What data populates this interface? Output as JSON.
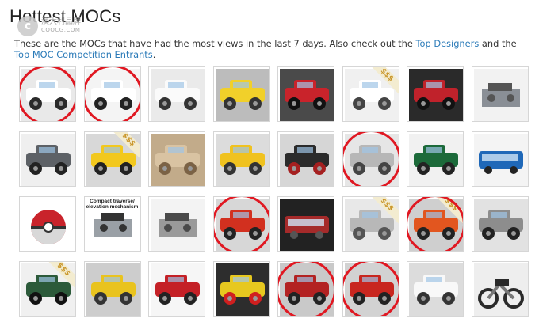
{
  "page": {
    "title": "Hottest MOCs",
    "watermark": {
      "cn": "澳大利品牌",
      "en": "COOCG.COM"
    },
    "intro": {
      "text_before": "These are the MOCs that have had the most views in the last 7 days. Also check out the ",
      "link1": "Top Designers",
      "text_middle": " and the ",
      "link2": "Top MOC Competition Entrants",
      "text_after": "."
    }
  },
  "colors": {
    "ring": "#e01822",
    "link": "#2a7ab8",
    "badge": "#c9962a"
  },
  "tiles": [
    {
      "icon": "white-offroad-truck",
      "ring": true,
      "sss": false,
      "caption": ""
    },
    {
      "icon": "white-supercar",
      "ring": true,
      "sss": false,
      "caption": ""
    },
    {
      "icon": "white-sports-car",
      "ring": false,
      "sss": false,
      "caption": ""
    },
    {
      "icon": "yellow-crane-vehicle",
      "ring": false,
      "sss": false,
      "caption": ""
    },
    {
      "icon": "red-tow-truck",
      "ring": false,
      "sss": false,
      "caption": ""
    },
    {
      "icon": "white-semi-truck",
      "ring": false,
      "sss": true,
      "caption": ""
    },
    {
      "icon": "red-black-supercar",
      "ring": false,
      "sss": false,
      "caption": ""
    },
    {
      "icon": "grey-technic-frame",
      "ring": false,
      "sss": false,
      "caption": ""
    },
    {
      "icon": "wrecking-ball-machine",
      "ring": false,
      "sss": false,
      "caption": ""
    },
    {
      "icon": "yellow-semi-truck",
      "ring": false,
      "sss": true,
      "caption": ""
    },
    {
      "icon": "beige-jeep",
      "ring": false,
      "sss": false,
      "caption": ""
    },
    {
      "icon": "yellow-lowloader",
      "ring": false,
      "sss": false,
      "caption": ""
    },
    {
      "icon": "black-truck",
      "ring": false,
      "sss": false,
      "caption": ""
    },
    {
      "icon": "grey-box-truck",
      "ring": true,
      "sss": false,
      "caption": ""
    },
    {
      "icon": "green-racing-car",
      "ring": false,
      "sss": false,
      "caption": ""
    },
    {
      "icon": "blue-city-bus",
      "ring": false,
      "sss": false,
      "caption": ""
    },
    {
      "icon": "pokeball-model",
      "ring": false,
      "sss": false,
      "caption": ""
    },
    {
      "icon": "traverse-mechanism",
      "ring": false,
      "sss": false,
      "caption": "Compact traverse/ elevation mechanism"
    },
    {
      "icon": "grey-robot-arm",
      "ring": false,
      "sss": false,
      "caption": ""
    },
    {
      "icon": "red-land-cruiser",
      "ring": true,
      "sss": false,
      "caption": ""
    },
    {
      "icon": "red-train",
      "ring": false,
      "sss": false,
      "caption": ""
    },
    {
      "icon": "star-destroyer",
      "ring": false,
      "sss": true,
      "caption": ""
    },
    {
      "icon": "orange-rally-truck",
      "ring": true,
      "sss": true,
      "caption": ""
    },
    {
      "icon": "grey-buggy",
      "ring": false,
      "sss": false,
      "caption": ""
    },
    {
      "icon": "green-classic-car",
      "ring": false,
      "sss": true,
      "caption": ""
    },
    {
      "icon": "yellow-mobile-crane",
      "ring": false,
      "sss": false,
      "caption": ""
    },
    {
      "icon": "red-beetle-car",
      "ring": false,
      "sss": false,
      "caption": ""
    },
    {
      "icon": "yellow-supercar",
      "ring": false,
      "sss": false,
      "caption": ""
    },
    {
      "icon": "red-forklift",
      "ring": true,
      "sss": false,
      "caption": ""
    },
    {
      "icon": "red-pickup-truck",
      "ring": true,
      "sss": false,
      "caption": ""
    },
    {
      "icon": "white-suv",
      "ring": false,
      "sss": false,
      "caption": ""
    },
    {
      "icon": "black-motorcycle",
      "ring": false,
      "sss": false,
      "caption": ""
    }
  ],
  "sss_label": "$$$"
}
